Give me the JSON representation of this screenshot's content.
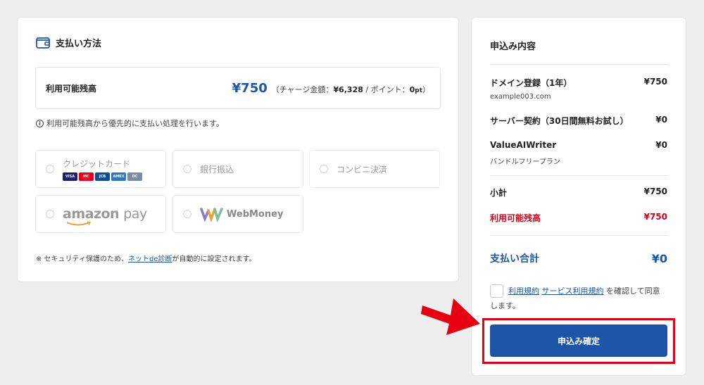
{
  "payment": {
    "title": "支払い方法",
    "balance_label": "利用可能残高",
    "balance_amount": "¥750",
    "balance_detail_prefix": "（チャージ金額：",
    "charge_amount": "¥6,328",
    "balance_detail_mid": " / ポイント：",
    "points_value": "0",
    "points_unit": "pt",
    "balance_detail_suffix": "）",
    "info_note": "利用可能残高から優先的に支払い処理を行います。",
    "options": {
      "credit_card": "クレジットカード",
      "bank_transfer": "銀行振込",
      "convenience_store": "コンビニ決済",
      "amazon_pay_brand": "amazon",
      "amazon_pay_suffix": "pay",
      "webmoney": "WebMoney"
    },
    "card_brands": [
      "VISA",
      "MC",
      "JCB",
      "AMEX",
      "DC"
    ],
    "security_prefix": "※ セキュリティ保護のため、",
    "security_link": "ネットde診断",
    "security_suffix": "が自動的に設定されます。"
  },
  "order": {
    "title": "申込み内容",
    "items": [
      {
        "name": "ドメイン登録（1年）",
        "price": "¥750",
        "sub": "example003.com"
      },
      {
        "name": "サーバー契約（30日間無料お試し）",
        "price": "¥0"
      },
      {
        "name": "ValueAIWriter",
        "price": "¥0",
        "sub": "バンドルフリープラン"
      }
    ],
    "subtotal_label": "小計",
    "subtotal_value": "¥750",
    "balance_label": "利用可能残高",
    "balance_value": "¥750",
    "total_label": "支払い合計",
    "total_value": "¥0",
    "terms_link_1": "利用規約",
    "terms_link_2": "サービス利用規約",
    "terms_suffix": " を確認して同意します。",
    "confirm_label": "申込み確定"
  },
  "colors": {
    "accent": "#1d56a8",
    "alert_red": "#d6001c",
    "highlight_red": "#e60012"
  }
}
